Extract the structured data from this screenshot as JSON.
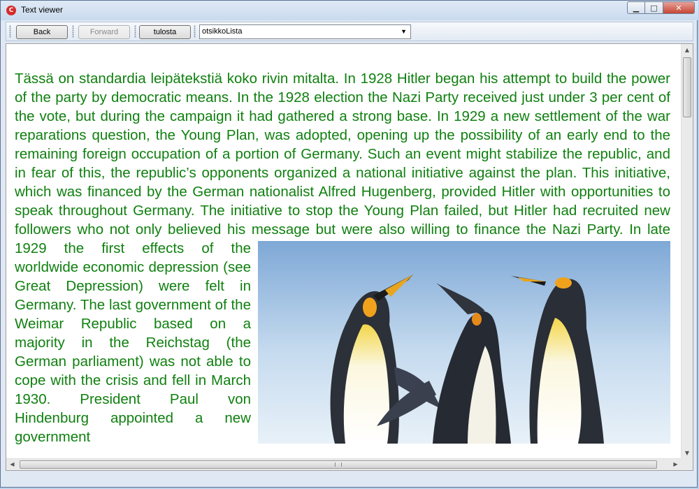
{
  "window": {
    "title": "Text viewer",
    "app_icon": "C"
  },
  "window_controls": {
    "minimize": "▁",
    "maximize": "□",
    "close": "✕"
  },
  "toolbar": {
    "back_label": "Back",
    "forward_label": "Forward",
    "print_label": "tulosta",
    "dropdown_value": "otsikkoLista",
    "dropdown_arrow": "▼"
  },
  "document": {
    "text_color": "#108010",
    "paragraph": "Tässä on standardia leipätekstiä koko rivin mitalta. In 1928 Hitler began his attempt to build the power of the party by democratic means. In the 1928 election the Nazi Party received just under 3 per cent of the vote, but during the campaign it had gathered a strong base. In 1929 a new settlement of the war reparations question, the Young Plan, was adopted, opening up the possibility of an early end to the remaining foreign occupation of a portion of Germany. Such an event might stabilize the republic, and in fear of this, the republic’s opponents organized a national initiative against the plan. This initiative, which was financed by the German nationalist Alfred Hugenberg, provided Hitler with opportunities to speak throughout Germany. The initiative to stop the Young Plan failed, but Hitler had recruited new followers who not only believed his message but were also willing to finance the Nazi Party. In late 1929 the first effects of the worldwide economic depression (see Great Depression) were felt in Germany. The last government of the Weimar Republic based on a majority in the Reichstag (the German parliament) was not able to cope with the crisis and fell in March 1930. President Paul von Hindenburg appointed a new government",
    "image": "penguins-photo"
  },
  "scrollbars": {
    "up_arrow": "▲",
    "down_arrow": "▼",
    "left_arrow": "◀",
    "right_arrow": "▶"
  }
}
